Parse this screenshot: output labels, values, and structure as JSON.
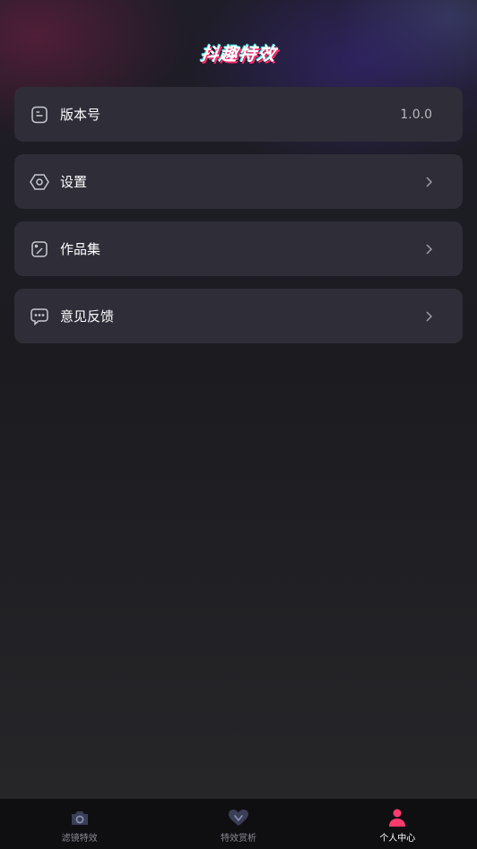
{
  "header": {
    "brand_title": "抖趣特效"
  },
  "menu": {
    "items": [
      {
        "label": "版本号",
        "value": "1.0.0",
        "icon": "document-icon"
      },
      {
        "label": "设置",
        "icon": "gear-icon"
      },
      {
        "label": "作品集",
        "icon": "gallery-icon"
      },
      {
        "label": "意见反馈",
        "icon": "chat-bubble-icon"
      }
    ]
  },
  "tabbar": {
    "tabs": [
      {
        "label": "滤镜特效",
        "icon": "camera-icon",
        "active": false
      },
      {
        "label": "特效赏析",
        "icon": "heart-icon",
        "active": false
      },
      {
        "label": "个人中心",
        "icon": "person-icon",
        "active": true
      }
    ]
  },
  "colors": {
    "accent": "#ff3b6e",
    "card_bg": "#2e2d38",
    "tab_inactive": "#8a8a93"
  }
}
